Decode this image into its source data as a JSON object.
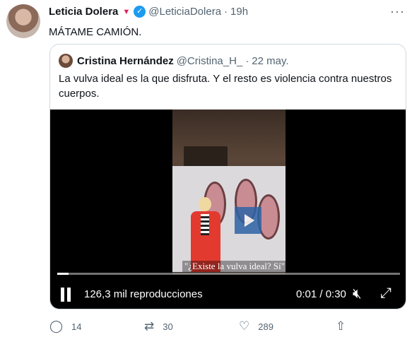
{
  "tweet": {
    "name": "Leticia Dolera",
    "handle": "@LeticiaDolera",
    "time": "19h",
    "text": "MÁTAME CAMIÓN.",
    "more": "···"
  },
  "quote": {
    "name": "Cristina Hernández",
    "handle": "@Cristina_H_",
    "date": "22 may.",
    "text": "La vulva ideal es la que disfruta. Y el resto es violencia contra nuestros cuerpos."
  },
  "video": {
    "subtitle": "\"¿Existe la vulva ideal? Sí\"",
    "views": "126,3 mil reproducciones",
    "duration": "0:01 / 0:30",
    "progress_fraction": 0.033
  },
  "actions": {
    "reply_count": "14",
    "retweet_count": "30",
    "like_count": "289"
  },
  "colors": {
    "accent": "#1d9bf0",
    "muted": "#536471",
    "heart": "#e0245e"
  }
}
